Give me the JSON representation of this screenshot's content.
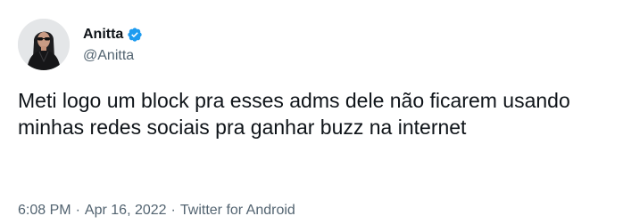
{
  "author": {
    "display_name": "Anitta",
    "handle": "@Anitta",
    "verified": true,
    "verified_color": "#1d9bf0",
    "avatar_icon": "profile-photo"
  },
  "tweet": {
    "text": "Meti logo um block pra esses adms dele não ficarem usando minhas redes sociais pra ganhar buzz na internet"
  },
  "meta": {
    "time": "6:08 PM",
    "separator": "·",
    "date": "Apr 16, 2022",
    "source": "Twitter for Android"
  }
}
